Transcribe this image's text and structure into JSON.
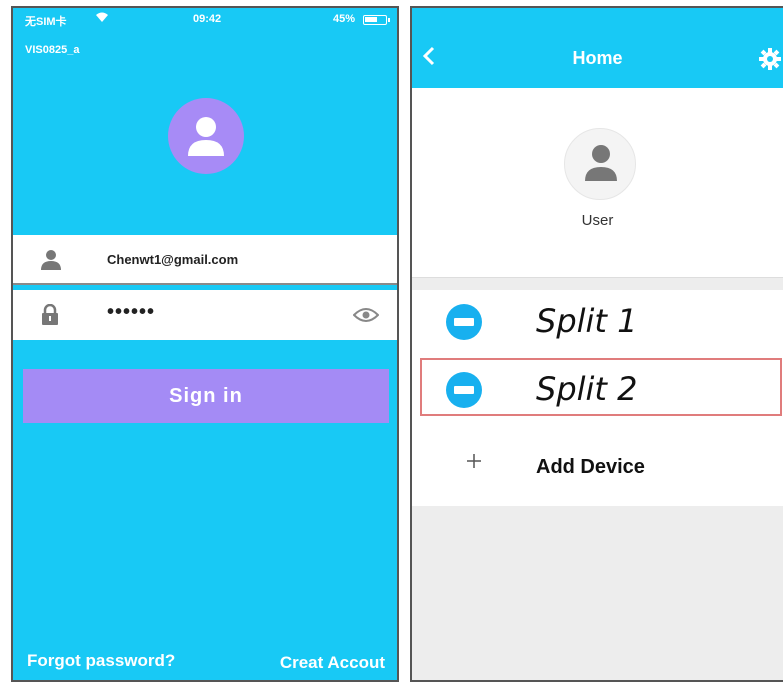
{
  "login": {
    "status": {
      "carrier": "无SIM卡",
      "time": "09:42",
      "battery": "45%"
    },
    "ssid": "VIS0825_a",
    "email": "Chenwt1@gmail.com",
    "password_mask": "••••••",
    "sign_in_label": "Sign in",
    "forgot_label": "Forgot password?",
    "create_label": "Creat Accout"
  },
  "home": {
    "title": "Home",
    "user_label": "User",
    "devices": [
      {
        "name": "Split 1"
      },
      {
        "name": "Split 2"
      }
    ],
    "add_device_label": "Add Device"
  },
  "colors": {
    "accent": "#18c9f5",
    "button": "#a48bf5",
    "device_icon": "#18b0ef",
    "highlight": "#e07c7c"
  }
}
